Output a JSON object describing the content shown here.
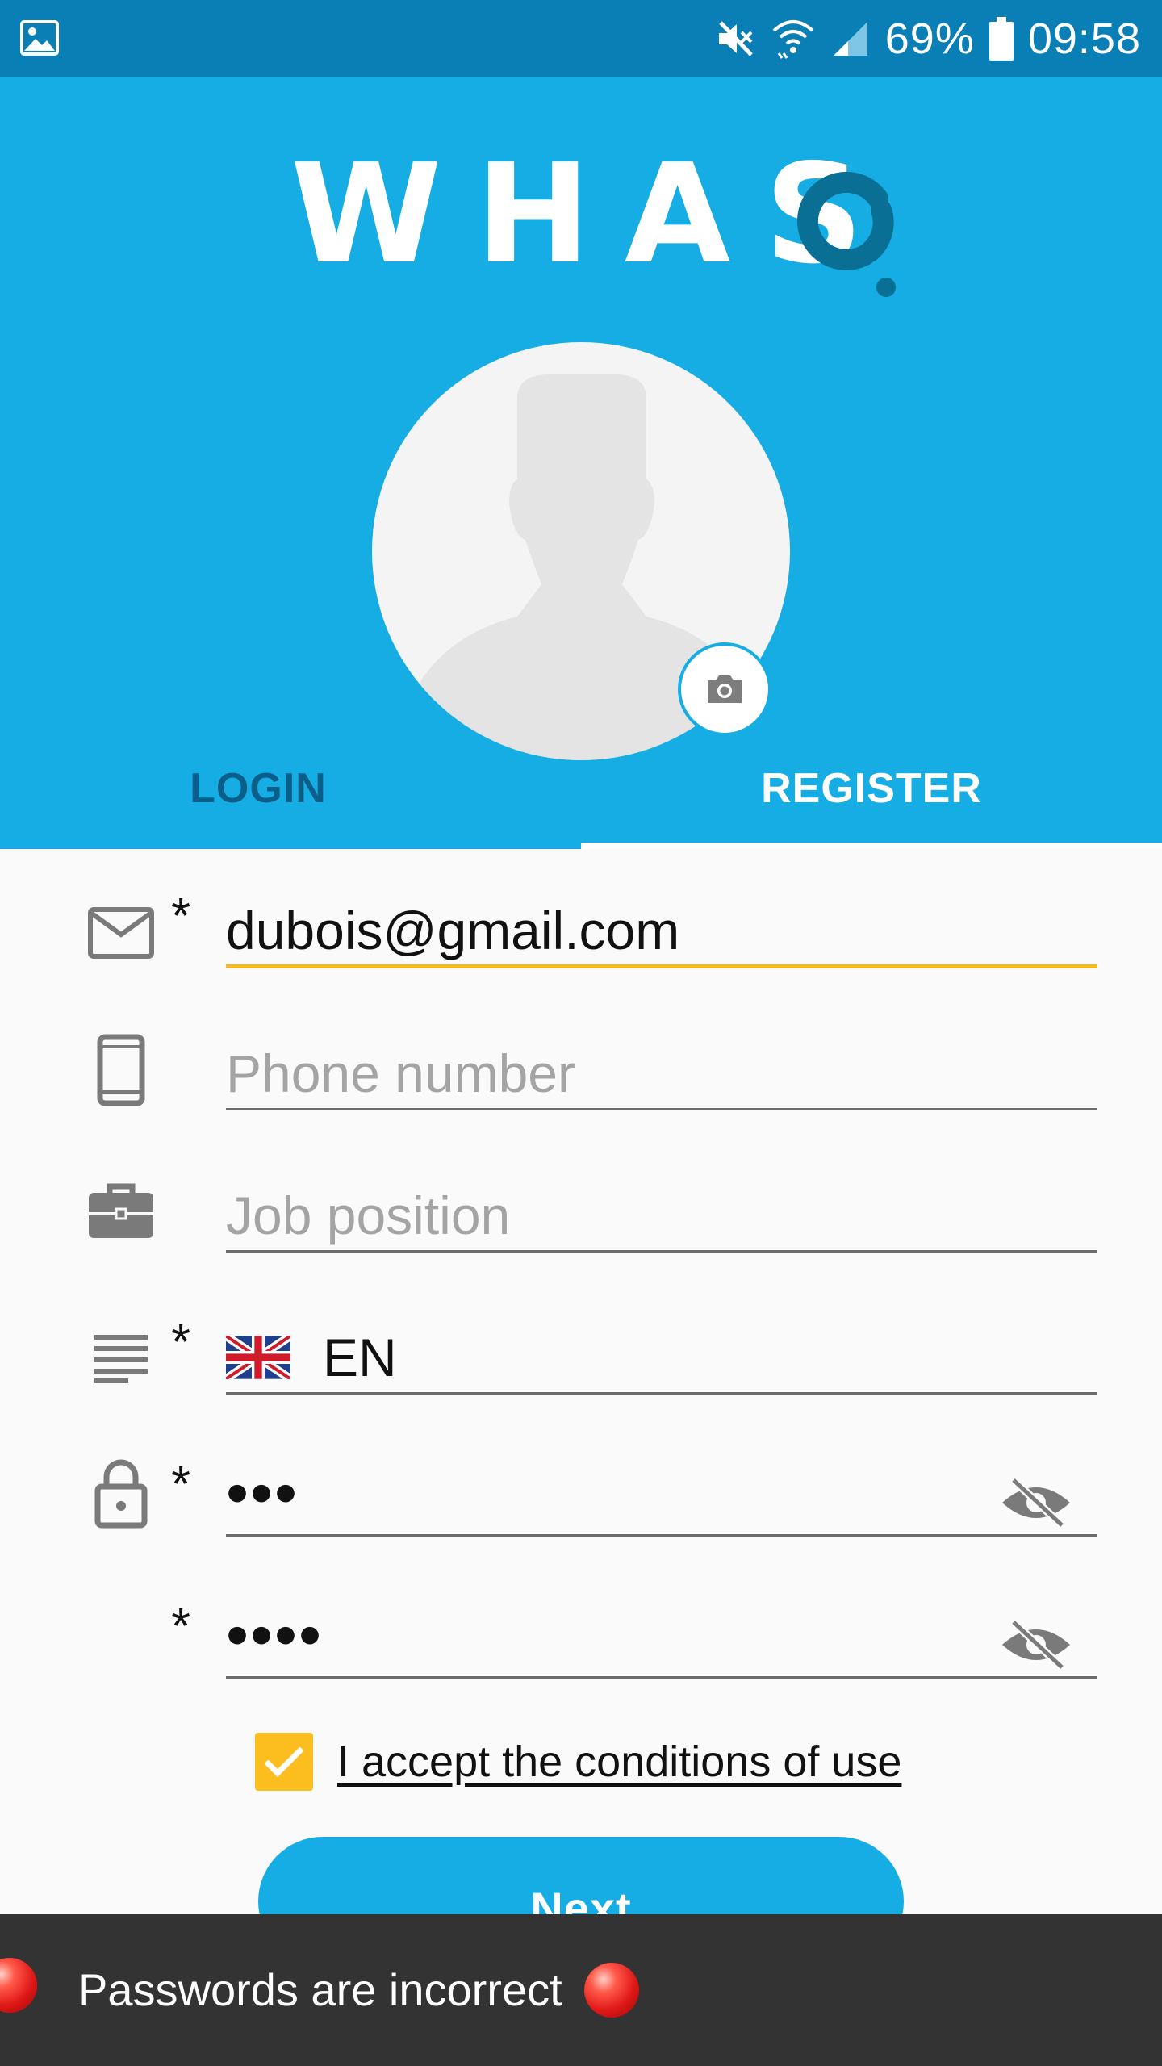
{
  "status_bar": {
    "battery": "69%",
    "time": "09:58",
    "icons": [
      "gallery-icon",
      "mute-icon",
      "wifi-icon",
      "signal-icon",
      "battery-icon"
    ]
  },
  "header": {
    "logo_text": "WHAS",
    "tabs": [
      {
        "label": "LOGIN",
        "active": false
      },
      {
        "label": "REGISTER",
        "active": true
      }
    ]
  },
  "form": {
    "required_mark": "*",
    "email": {
      "value": "dubois@gmail.com",
      "required": true
    },
    "phone": {
      "placeholder": "Phone number"
    },
    "job": {
      "placeholder": "Job position"
    },
    "language": {
      "value": "EN",
      "flag": "uk-flag-icon",
      "required": true
    },
    "password": {
      "value": "•••",
      "required": true
    },
    "confirm_password": {
      "value": "••••",
      "required": true
    },
    "terms": {
      "label": "I accept the conditions of use",
      "checked": true
    },
    "next_label": "Next"
  },
  "toast": {
    "message": "Passwords are incorrect"
  },
  "colors": {
    "primary": "#15ade3",
    "status_bar": "#0a7fb5",
    "accent": "#f7b91e",
    "toast_bg": "#333333"
  }
}
